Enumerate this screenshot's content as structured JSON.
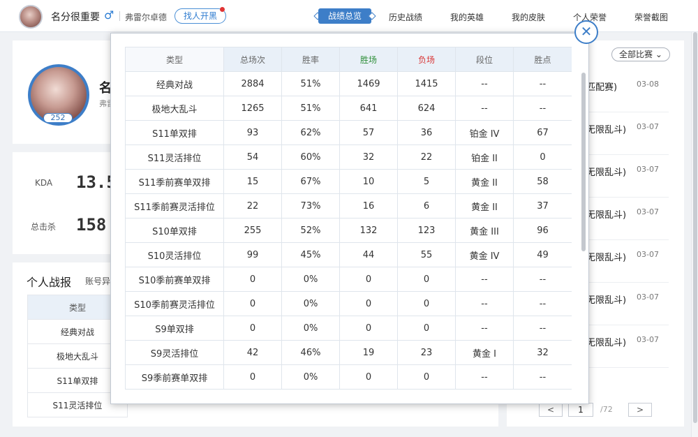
{
  "header": {
    "username": "名分很重要",
    "gender_symbol": "♂",
    "server": "弗雷尔卓德",
    "find_button": "找人开黑",
    "nav": [
      "战绩总览",
      "历史战绩",
      "我的英雄",
      "我的皮肤",
      "个人荣誉",
      "荣誉截图"
    ]
  },
  "profile": {
    "name_partial": "名",
    "server_partial": "弗雷",
    "level": "252"
  },
  "kda": {
    "kda_label": "KDA",
    "kda_value": "13.5",
    "kills_label": "总击杀",
    "kills_value": "158"
  },
  "report": {
    "title": "个人战报",
    "subtitle_partial": "账号异",
    "bg_rows": [
      "类型",
      "经典对战",
      "极地大乱斗",
      "S11单双排",
      "S11灵活排位"
    ]
  },
  "matches": {
    "filter": "全部比赛",
    "items": [
      {
        "name": "匹配赛)",
        "date": "03-08"
      },
      {
        "name": "无限乱斗)",
        "date": "03-07"
      },
      {
        "name": "无限乱斗)",
        "date": "03-07"
      },
      {
        "name": "无限乱斗)",
        "date": "03-07"
      },
      {
        "name": "无限乱斗)",
        "date": "03-07"
      },
      {
        "name": "无限乱斗)",
        "date": "03-07"
      },
      {
        "name": "无限乱斗)",
        "date": "03-07"
      }
    ],
    "pager": {
      "prev": "<",
      "current": "1",
      "total": "/72",
      "next": ">"
    }
  },
  "modal": {
    "close": "✕",
    "columns": [
      "类型",
      "总场次",
      "胜率",
      "胜场",
      "负场",
      "段位",
      "胜点"
    ],
    "rows": [
      [
        "经典对战",
        "2884",
        "51%",
        "1469",
        "1415",
        "--",
        "--"
      ],
      [
        "极地大乱斗",
        "1265",
        "51%",
        "641",
        "624",
        "--",
        "--"
      ],
      [
        "S11单双排",
        "93",
        "62%",
        "57",
        "36",
        "铂金 IV",
        "67"
      ],
      [
        "S11灵活排位",
        "54",
        "60%",
        "32",
        "22",
        "铂金 II",
        "0"
      ],
      [
        "S11季前赛单双排",
        "15",
        "67%",
        "10",
        "5",
        "黄金 II",
        "58"
      ],
      [
        "S11季前赛灵活排位",
        "22",
        "73%",
        "16",
        "6",
        "黄金 II",
        "37"
      ],
      [
        "S10单双排",
        "255",
        "52%",
        "132",
        "123",
        "黄金 III",
        "96"
      ],
      [
        "S10灵活排位",
        "99",
        "45%",
        "44",
        "55",
        "黄金 IV",
        "49"
      ],
      [
        "S10季前赛单双排",
        "0",
        "0%",
        "0",
        "0",
        "--",
        "--"
      ],
      [
        "S10季前赛灵活排位",
        "0",
        "0%",
        "0",
        "0",
        "--",
        "--"
      ],
      [
        "S9单双排",
        "0",
        "0%",
        "0",
        "0",
        "--",
        "--"
      ],
      [
        "S9灵活排位",
        "42",
        "46%",
        "19",
        "23",
        "黄金 I",
        "32"
      ],
      [
        "S9季前赛单双排",
        "0",
        "0%",
        "0",
        "0",
        "--",
        "--"
      ]
    ]
  }
}
